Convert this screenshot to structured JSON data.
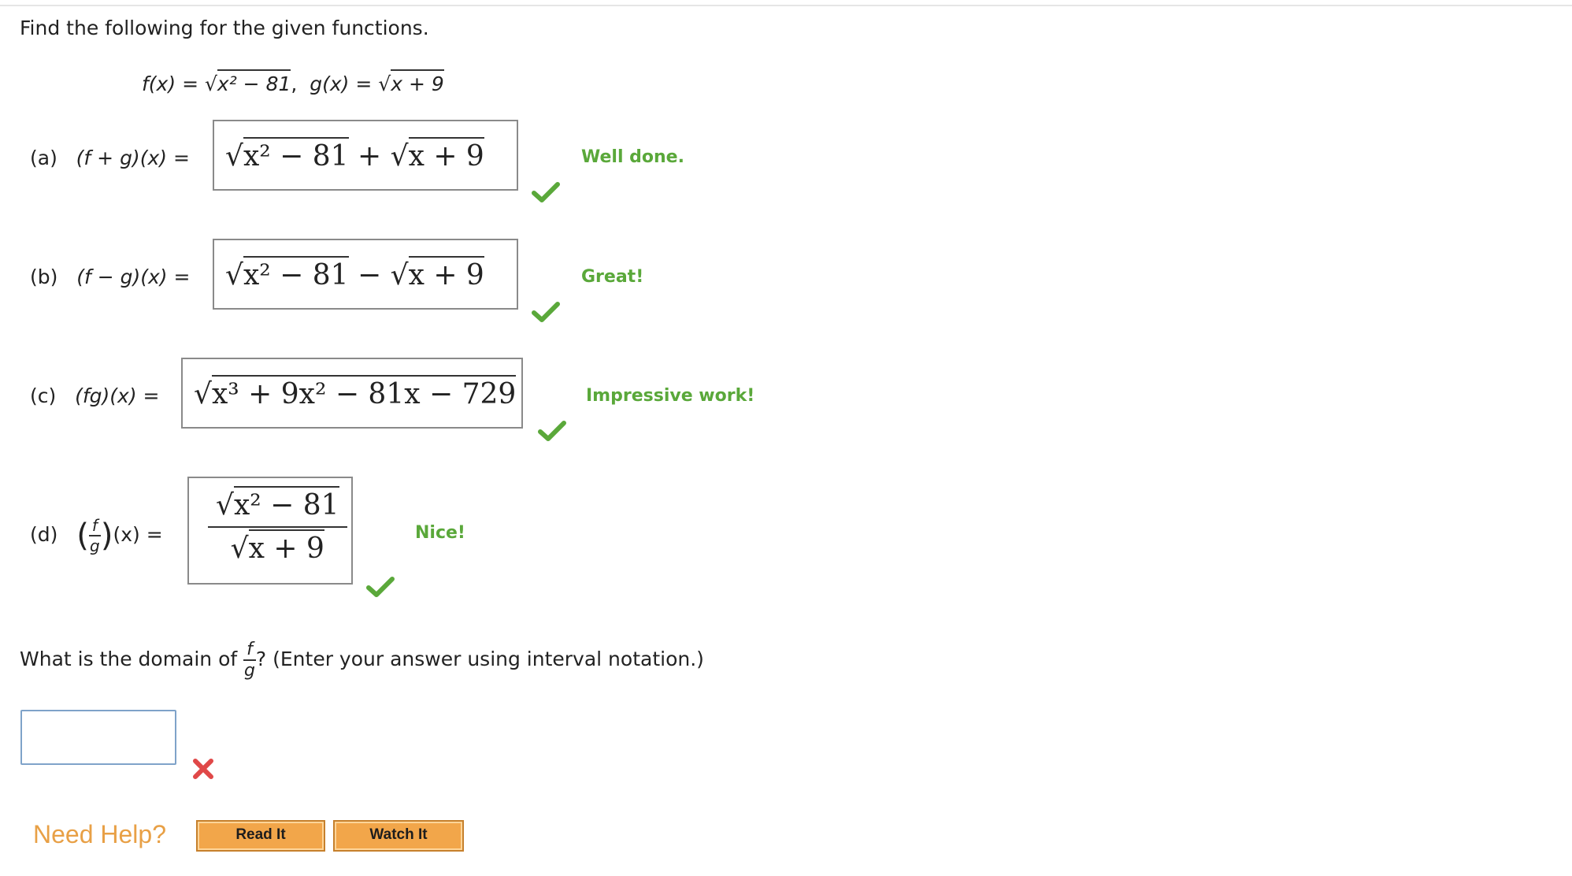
{
  "prompt": "Find the following for the given functions.",
  "given": {
    "f_label": "f(x)",
    "f_expr": "x² − 81",
    "sep": ",",
    "g_label": "g(x)",
    "g_expr": "x + 9",
    "eq": "="
  },
  "parts": [
    {
      "letter": "(a)",
      "label": "(f + g)(x)",
      "answer_left": "x² − 81",
      "op": "+",
      "answer_right": "x + 9",
      "feedback": "Well done."
    },
    {
      "letter": "(b)",
      "label": "(f − g)(x)",
      "answer_left": "x² − 81",
      "op": "−",
      "answer_right": "x + 9",
      "feedback": "Great!"
    },
    {
      "letter": "(c)",
      "label": "(fg)(x)",
      "answer": "x³ + 9x² − 81x − 729",
      "feedback": "Impressive work!"
    },
    {
      "letter": "(d)",
      "label_num": "f",
      "label_den": "g",
      "label_tail": "(x)",
      "answer_num": "x² − 81",
      "answer_den": "x + 9",
      "feedback": "Nice!"
    }
  ],
  "domain_question": {
    "before": "What is the domain of",
    "frac_num": "f",
    "frac_den": "g",
    "after": "? (Enter your answer using interval notation.)",
    "input_value": "",
    "input_placeholder": ""
  },
  "help": {
    "label": "Need Help?",
    "read_button": "Read It",
    "watch_button": "Watch It"
  },
  "colors": {
    "feedback_green": "#5aa83a",
    "check_green": "#5aa83a",
    "error_red": "#e04848",
    "help_orange": "#e8a046",
    "button_orange": "#f2a64a"
  },
  "icons": {
    "correct": "checkmark-icon",
    "incorrect": "x-mark-icon",
    "radical": "square-root-symbol"
  }
}
